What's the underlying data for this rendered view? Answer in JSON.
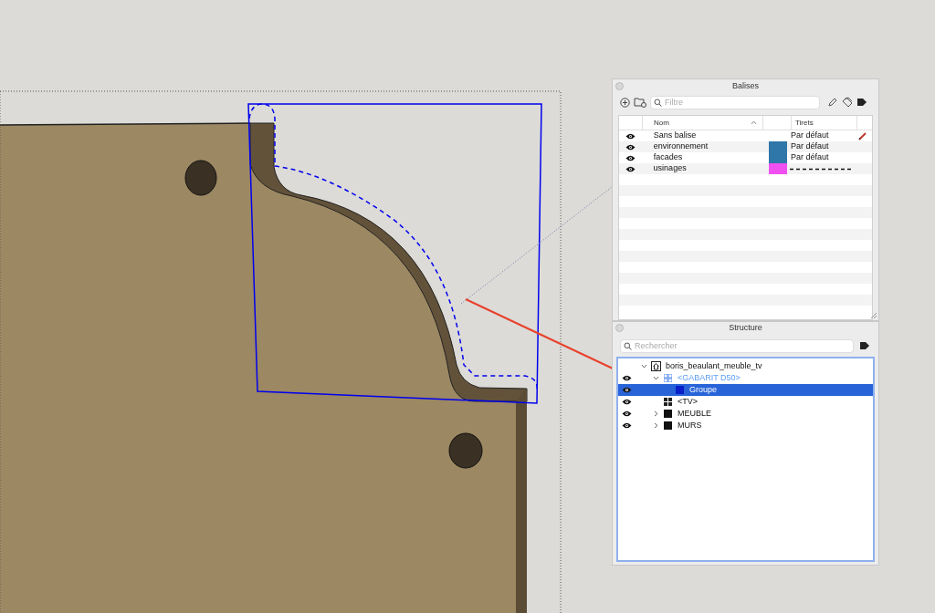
{
  "tags_panel": {
    "title": "Balises",
    "search": {
      "placeholder": "Filtre"
    },
    "columns": [
      "Nom",
      "Tirets"
    ],
    "rows": [
      {
        "name": "Sans balise",
        "visible": true,
        "active": true,
        "kind": "text",
        "dashes": "Par défaut"
      },
      {
        "name": "environnement",
        "visible": true,
        "active": false,
        "color": "#2e77a8",
        "kind": "text",
        "dashes": "Par défaut"
      },
      {
        "name": "facades",
        "visible": true,
        "active": false,
        "color": "#2e77a8",
        "kind": "text",
        "dashes": "Par défaut"
      },
      {
        "name": "usinages",
        "visible": true,
        "active": false,
        "color": "#f050f0",
        "kind": "dashed"
      }
    ]
  },
  "structure_panel": {
    "title": "Structure",
    "search": {
      "placeholder": "Rechercher"
    },
    "tree": [
      {
        "label": "boris_beaulant_meuble_tv",
        "kind": "model",
        "expandable": true,
        "expanded": true,
        "selected": false,
        "open_for_edit": false,
        "children": [
          {
            "label": "<GABARIT D50>",
            "kind": "component",
            "visible": true,
            "expandable": true,
            "expanded": true,
            "selected": false,
            "open_for_edit": true,
            "children": [
              {
                "label": "Groupe",
                "kind": "group",
                "visible": true,
                "expandable": false,
                "selected": true,
                "open_for_edit": false
              }
            ]
          },
          {
            "label": "<TV>",
            "kind": "component",
            "visible": true,
            "expandable": false,
            "selected": false,
            "open_for_edit": false
          },
          {
            "label": "MEUBLE",
            "kind": "group",
            "visible": true,
            "expandable": true,
            "expanded": false,
            "selected": false,
            "open_for_edit": false
          },
          {
            "label": "MURS",
            "kind": "group",
            "visible": true,
            "expandable": true,
            "expanded": false,
            "selected": false,
            "open_for_edit": false
          }
        ]
      }
    ]
  }
}
